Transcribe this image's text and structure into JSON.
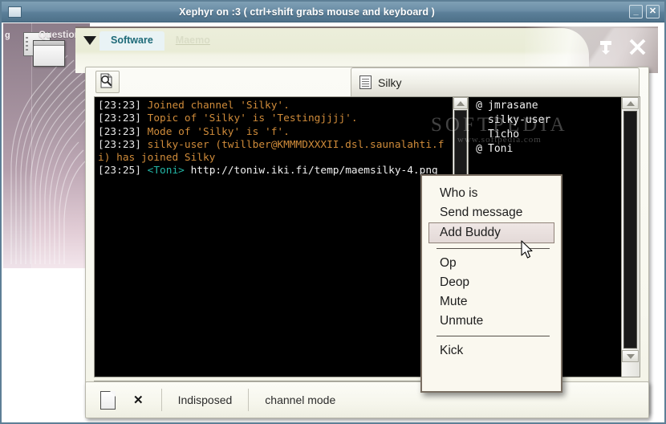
{
  "xephyr": {
    "title": "Xephyr on :3 ( ctrl+shift grabs mouse and keyboard )",
    "minimize_label": "_",
    "close_label": "✕"
  },
  "desktop": {
    "left_letter": "g",
    "questions_label": "Questions"
  },
  "app": {
    "tabs": [
      {
        "label": "Software",
        "state": "active"
      },
      {
        "label": "Maemo",
        "state": "inactive"
      }
    ],
    "header_buttons": [
      {
        "name": "minimize-icon",
        "label": "⤓"
      },
      {
        "name": "close-icon",
        "label": "✕"
      }
    ],
    "toolbar": {
      "find_icon": "find-document-icon",
      "channel_title": "Silky",
      "channel_icon": "document-lines-icon"
    }
  },
  "chat": {
    "lines": [
      {
        "time": "[23:23]",
        "type": "system",
        "text": " Joined channel 'Silky'."
      },
      {
        "time": "[23:23]",
        "type": "system",
        "text": " Topic of 'Silky' is 'Testingjjjj'."
      },
      {
        "time": "[23:23]",
        "type": "system",
        "text": " Mode of 'Silky' is 'f'."
      },
      {
        "time": "[23:23]",
        "type": "system",
        "text": " silky-user (twillber@KMMMDXXXII.dsl.saunalahti.fi) has joined Silky"
      },
      {
        "time": "[23:25]",
        "type": "message",
        "nick": "<Toni>",
        "text": " http://toniw.iki.fi/temp/maemsilky-4.png"
      }
    ],
    "input_value": "",
    "input_placeholder": ""
  },
  "userlist": [
    {
      "mode": "@",
      "nick": "jmrasane"
    },
    {
      "mode": "",
      "nick": "silky-user"
    },
    {
      "mode": "",
      "nick": "Ticho"
    },
    {
      "mode": "@",
      "nick": "Toni"
    }
  ],
  "context_menu": {
    "items": [
      {
        "label": "Who is",
        "selected": false
      },
      {
        "label": "Send message",
        "selected": false
      },
      {
        "label": "Add Buddy",
        "selected": true
      },
      {
        "separator": true
      },
      {
        "label": "Op",
        "selected": false
      },
      {
        "label": "Deop",
        "selected": false
      },
      {
        "label": "Mute",
        "selected": false
      },
      {
        "label": "Unmute",
        "selected": false
      },
      {
        "separator": true
      },
      {
        "label": "Kick",
        "selected": false
      }
    ]
  },
  "statusbar": {
    "doc_icon": "new-document-icon",
    "close_icon": "close-x-icon",
    "close_label": "✕",
    "status": "Indisposed",
    "mode": "channel mode"
  },
  "watermark": {
    "main": "SOFTPEDIA",
    "sub": "www.softpedia.com"
  },
  "colors": {
    "titlebar": "#5b7f99",
    "chat_background": "#000000",
    "system_text": "#cf8b3a",
    "nick_text": "#23b6a6",
    "tab_active_text": "#1d6a78",
    "menu_background": "#faf8ef"
  }
}
